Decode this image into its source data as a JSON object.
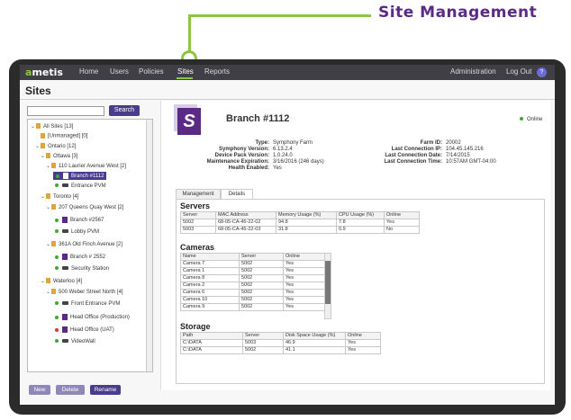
{
  "callout": {
    "title": "Site Management"
  },
  "nav": {
    "logo_a": "a",
    "logo_rest": "metis",
    "items": [
      "Home",
      "Users",
      "Policies",
      "Sites",
      "Reports"
    ],
    "admin": "Administration",
    "logout": "Log Out",
    "help": "?"
  },
  "page": {
    "title": "Sites"
  },
  "search": {
    "button": "Search",
    "placeholder": ""
  },
  "tree": {
    "all_sites": "All Sites [13]",
    "unmanaged": "[Unmanaged] [0]",
    "ontario": "Ontario [12]",
    "ottawa": "Ottawa [3]",
    "laurier": "110 Laurier Avenue West [2]",
    "branch1112": "Branch #1112",
    "entrance_pvm": "Entrance PVM",
    "toronto": "Toronto [4]",
    "queens": "207 Queens Quay West [2]",
    "branch2567": "Branch #2567",
    "lobby_pvm": "Lobby PVM",
    "finch": "361A Old Finch Avenue [2]",
    "branch2552": "Branch # 2552",
    "security_station": "Security Station",
    "waterloo": "Waterloo [4]",
    "weber": "500 Weber Street North [4]",
    "front_entrance": "Front Entrance PVM",
    "head_office_prod": "Head Office (Production)",
    "head_office_uat": "Head Office (UAT)",
    "videowall": "VideoWall"
  },
  "buttons": {
    "new": "New",
    "delete": "Delete",
    "rename": "Rename"
  },
  "site": {
    "logo_letter": "S",
    "name": "Branch #1112",
    "status": "Online",
    "type_label": "Type:",
    "type": "Symphony Farm",
    "version_label": "Symphony Version:",
    "version": "6.13.2.4",
    "device_pack_label": "Device Pack Version:",
    "device_pack": "1.0.24.0",
    "maintenance_label": "Maintenance Expiration:",
    "maintenance": "3/16/2016 (246 days)",
    "health_label": "Health Enabled:",
    "health": "Yes",
    "farm_id_label": "Farm ID:",
    "farm_id": "20002",
    "last_ip_label": "Last Connection IP:",
    "last_ip": "104.45.145.216",
    "last_date_label": "Last Connection Date:",
    "last_date": "7/14/2015",
    "last_time_label": "Last Connection Time:",
    "last_time": "10:57AM GMT-04:00"
  },
  "tabs": {
    "management": "Management",
    "details": "Details"
  },
  "servers": {
    "title": "Servers",
    "headers": [
      "Server",
      "MAC Address",
      "Memory Usage (%)",
      "CPU Usage (%)",
      "Online"
    ],
    "rows": [
      [
        "5002",
        "68-05-CA-45-22-02",
        "94.8",
        "7.8",
        "Yes"
      ],
      [
        "5003",
        "68-05-CA-45-22-03",
        "31.8",
        "0.9",
        "No"
      ]
    ]
  },
  "cameras": {
    "title": "Cameras",
    "headers": [
      "Name",
      "Server",
      "Online"
    ],
    "rows": [
      [
        "Camera 7",
        "5002",
        "Yes"
      ],
      [
        "Camera 1",
        "5002",
        "Yes"
      ],
      [
        "Camera 8",
        "5002",
        "Yes"
      ],
      [
        "Camera 2",
        "5002",
        "Yes"
      ],
      [
        "Camera 6",
        "5002",
        "Yes"
      ],
      [
        "Camera 10",
        "5002",
        "Yes"
      ],
      [
        "Camera 9",
        "5002",
        "Yes"
      ]
    ]
  },
  "storage": {
    "title": "Storage",
    "headers": [
      "Path",
      "Server",
      "Disk Space Usage (%)",
      "Online"
    ],
    "rows": [
      [
        "C:\\DATA",
        "5003",
        "46.9",
        "Yes"
      ],
      [
        "C:\\DATA",
        "5002",
        "41.1",
        "Yes"
      ]
    ]
  },
  "colors": {
    "accent": "#8cc63f",
    "brand": "#5b2a86",
    "button": "#4a3b8f",
    "nav_bg": "#3f3f45"
  }
}
